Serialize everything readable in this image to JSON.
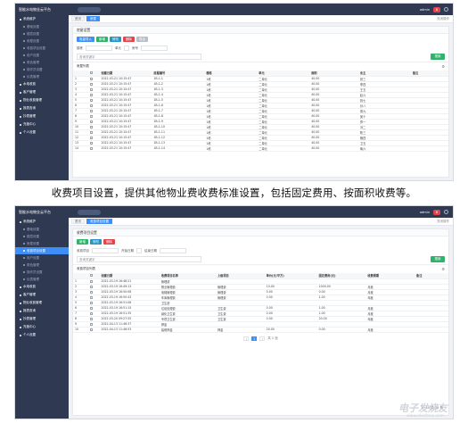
{
  "caption": "收费项目设置，提供其他物业费收费标准设置，包括固定费用、按面积收费等。",
  "watermark": {
    "main": "电子发烧友",
    "sub": "www.elecfans.com"
  },
  "shot1": {
    "app_title": "智能水电物业云平台",
    "top_pill": "",
    "user": "admin",
    "badge": "8",
    "sidebar": [
      {
        "label": "系统维护",
        "kind": "group"
      },
      {
        "label": "基础设置",
        "kind": "sub"
      },
      {
        "label": "楼层设置",
        "kind": "sub"
      },
      {
        "label": "房屋设置",
        "kind": "sub"
      },
      {
        "label": "收费项目设置",
        "kind": "sub"
      },
      {
        "label": "用户设置",
        "kind": "sub"
      },
      {
        "label": "角色管理",
        "kind": "sub"
      },
      {
        "label": "操作员设置",
        "kind": "sub"
      },
      {
        "label": "仪表管理",
        "kind": "sub"
      },
      {
        "label": "水电收费",
        "kind": "group"
      },
      {
        "label": "客户管理",
        "kind": "group"
      },
      {
        "label": "物业收费管理",
        "kind": "group"
      },
      {
        "label": "报表查询",
        "kind": "group"
      },
      {
        "label": "抄表管理",
        "kind": "group"
      },
      {
        "label": "充值中心",
        "kind": "group"
      },
      {
        "label": "个人设置",
        "kind": "group"
      }
    ],
    "tabs": [
      "首页",
      "房屋"
    ],
    "tab_extra": "关闭操作",
    "panel_title": "房屋设置",
    "buttons": [
      "批量导入",
      "新增",
      "修改",
      "删除",
      "导出"
    ],
    "filter_label1": "楼栋",
    "filter_label2": "单元",
    "filter_label3": "房号",
    "search_placeholder": "查询关键字",
    "search_btn": "搜索",
    "section": "房屋列表",
    "columns": [
      "",
      "",
      "创建日期",
      "房屋编号",
      "楼栋",
      "单元",
      "面积",
      "业主",
      "备注"
    ],
    "rows": [
      [
        "1",
        "2022-03-21 10:15:47",
        "1B-1-1",
        "1栋",
        "二单元",
        "40.00",
        "张三",
        ""
      ],
      [
        "2",
        "2022-03-21 10:15:47",
        "1B-1-2",
        "1栋",
        "二单元",
        "40.00",
        "李四",
        ""
      ],
      [
        "3",
        "2022-03-21 10:15:47",
        "1B-1-3",
        "1栋",
        "二单元",
        "40.00",
        "王五",
        ""
      ],
      [
        "4",
        "2022-03-21 10:15:47",
        "1B-1-4",
        "1栋",
        "二单元",
        "40.00",
        "赵六",
        ""
      ],
      [
        "5",
        "2022-03-21 10:15:47",
        "1B-1-5",
        "1栋",
        "二单元",
        "40.00",
        "钱七",
        ""
      ],
      [
        "6",
        "2022-03-21 10:15:47",
        "1B-1-6",
        "1栋",
        "二单元",
        "40.00",
        "孙八",
        ""
      ],
      [
        "7",
        "2022-03-21 10:15:47",
        "1B-1-7",
        "1栋",
        "二单元",
        "40.00",
        "周九",
        ""
      ],
      [
        "8",
        "2022-03-21 10:15:47",
        "1B-1-8",
        "1栋",
        "二单元",
        "40.00",
        "吴十",
        ""
      ],
      [
        "9",
        "2022-03-21 10:15:47",
        "1B-1-9",
        "1栋",
        "二单元",
        "40.00",
        "郑一",
        ""
      ],
      [
        "10",
        "2022-03-21 10:15:47",
        "1B-1-10",
        "1栋",
        "二单元",
        "40.00",
        "冯二",
        ""
      ],
      [
        "11",
        "2022-03-21 10:15:47",
        "1B-1-11",
        "1栋",
        "二单元",
        "40.00",
        "陈三",
        ""
      ],
      [
        "12",
        "2022-03-21 10:15:47",
        "1B-1-12",
        "1栋",
        "二单元",
        "40.00",
        "褚四",
        ""
      ],
      [
        "13",
        "2022-03-21 10:15:47",
        "1B-1-13",
        "1栋",
        "二单元",
        "40.00",
        "卫五",
        ""
      ],
      [
        "14",
        "2022-03-21 10:15:47",
        "1B-1-14",
        "1栋",
        "二单元",
        "40.00",
        "蒋六",
        ""
      ]
    ]
  },
  "shot2": {
    "app_title": "智能水电物业云平台",
    "user": "admin",
    "badge": "8",
    "sidebar": [
      {
        "label": "系统维护",
        "kind": "group"
      },
      {
        "label": "基础设置",
        "kind": "sub"
      },
      {
        "label": "楼层设置",
        "kind": "sub"
      },
      {
        "label": "房屋设置",
        "kind": "sub"
      },
      {
        "label": "收费项目设置",
        "kind": "active"
      },
      {
        "label": "用户设置",
        "kind": "sub"
      },
      {
        "label": "角色管理",
        "kind": "sub"
      },
      {
        "label": "操作员设置",
        "kind": "sub"
      },
      {
        "label": "仪表管理",
        "kind": "sub"
      },
      {
        "label": "水电收费",
        "kind": "group"
      },
      {
        "label": "客户管理",
        "kind": "group"
      },
      {
        "label": "物业收费管理",
        "kind": "group"
      },
      {
        "label": "报表查询",
        "kind": "group"
      },
      {
        "label": "抄表管理",
        "kind": "group"
      },
      {
        "label": "充值中心",
        "kind": "group"
      },
      {
        "label": "个人设置",
        "kind": "group"
      }
    ],
    "tabs": [
      "首页",
      "收费项目设置"
    ],
    "tab_extra": "关闭操作",
    "panel_title": "收费项目设置",
    "buttons": [
      "新增",
      "修改",
      "删除"
    ],
    "filter_label1": "收费项目",
    "filter_label2": "开始日期",
    "filter_label3": "结束日期",
    "search_placeholder": "查询关键字",
    "search_btn": "搜索",
    "section": "收费项目列表",
    "columns": [
      "",
      "",
      "创建日期",
      "收费项目名称",
      "上级项目",
      "单价(元/平方)",
      "固定费用(元)",
      "收费周期",
      "备注"
    ],
    "rows": [
      [
        "1",
        "2022-03-19 16:48:21",
        "管理费",
        "",
        "",
        "",
        "",
        ""
      ],
      [
        "2",
        "2022-03-19 16:49:13",
        "物业管理费",
        "管理费",
        "10.00",
        "1000.00",
        "月度",
        ""
      ],
      [
        "3",
        "2022-03-19 16:50:06",
        "电梯管理费",
        "管理费",
        "0.00",
        "0.00",
        "月度",
        ""
      ],
      [
        "4",
        "2022-03-19 16:50:43",
        "车库管理费",
        "管理费",
        "0.00",
        "1.00",
        "年度",
        ""
      ],
      [
        "5",
        "2022-03-19 16:51:06",
        "卫生费",
        "",
        "",
        "",
        "",
        ""
      ],
      [
        "6",
        "2022-03-19 16:51:15",
        "垃圾处理费",
        "卫生费",
        "0.00",
        "1.00",
        "月度",
        ""
      ],
      [
        "7",
        "2022-03-19 16:51:35",
        "绿化卫生费",
        "卫生费",
        "0.00",
        "1.00",
        "月度",
        ""
      ],
      [
        "8",
        "2022-03-20 09:27:55",
        "专项卫生费",
        "卫生费",
        "0.00",
        "20.00",
        "年度",
        ""
      ],
      [
        "9",
        "2022-04-13 11:46:37",
        "押金",
        "",
        "",
        "",
        "",
        ""
      ],
      [
        "10",
        "2022-04-13 11:46:53",
        "装修押金",
        "押金",
        "20.00",
        "0.00",
        "月度",
        ""
      ]
    ],
    "pager_total": "共 1 页",
    "pager_current": "1",
    "pager_info": "1 - 10 共 10 条"
  }
}
